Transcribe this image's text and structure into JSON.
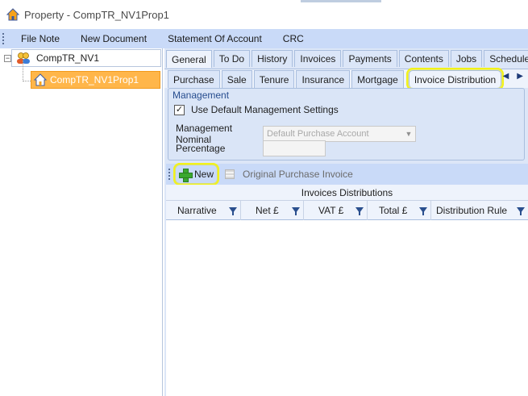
{
  "window": {
    "title": "Property - CompTR_NV1Prop1",
    "icon": "house-icon"
  },
  "menu": {
    "items": [
      "File Note",
      "New Document",
      "Statement Of Account",
      "CRC"
    ]
  },
  "tree": {
    "root": {
      "label": "CompTR_NV1",
      "icon": "people-icon"
    },
    "child": {
      "label": "CompTR_NV1Prop1",
      "icon": "house-icon"
    }
  },
  "tabs_primary": [
    "General",
    "To Do",
    "History",
    "Invoices",
    "Payments",
    "Contents",
    "Jobs",
    "Schedules"
  ],
  "tabs_primary_active": "General",
  "tabs_secondary": [
    "Purchase",
    "Sale",
    "Tenure",
    "Insurance",
    "Mortgage",
    "Invoice Distribution"
  ],
  "tabs_secondary_active": "Invoice Distribution",
  "management": {
    "heading": "Management",
    "use_default_label": "Use Default Management Settings",
    "use_default_checked": true,
    "nominal_label": "Management Nominal",
    "nominal_value": "Default Purchase Account",
    "percentage_label": "Percentage",
    "percentage_value": ""
  },
  "toolbar": {
    "new_label": "New",
    "original_label": "Original Purchase Invoice"
  },
  "grid": {
    "caption": "Invoices Distributions",
    "columns": [
      "Narrative",
      "Net £",
      "VAT £",
      "Total £",
      "Distribution Rule"
    ]
  },
  "colors": {
    "accent": "#c9daf8",
    "highlight": "#f2f21a",
    "selected": "#ffb64a"
  }
}
